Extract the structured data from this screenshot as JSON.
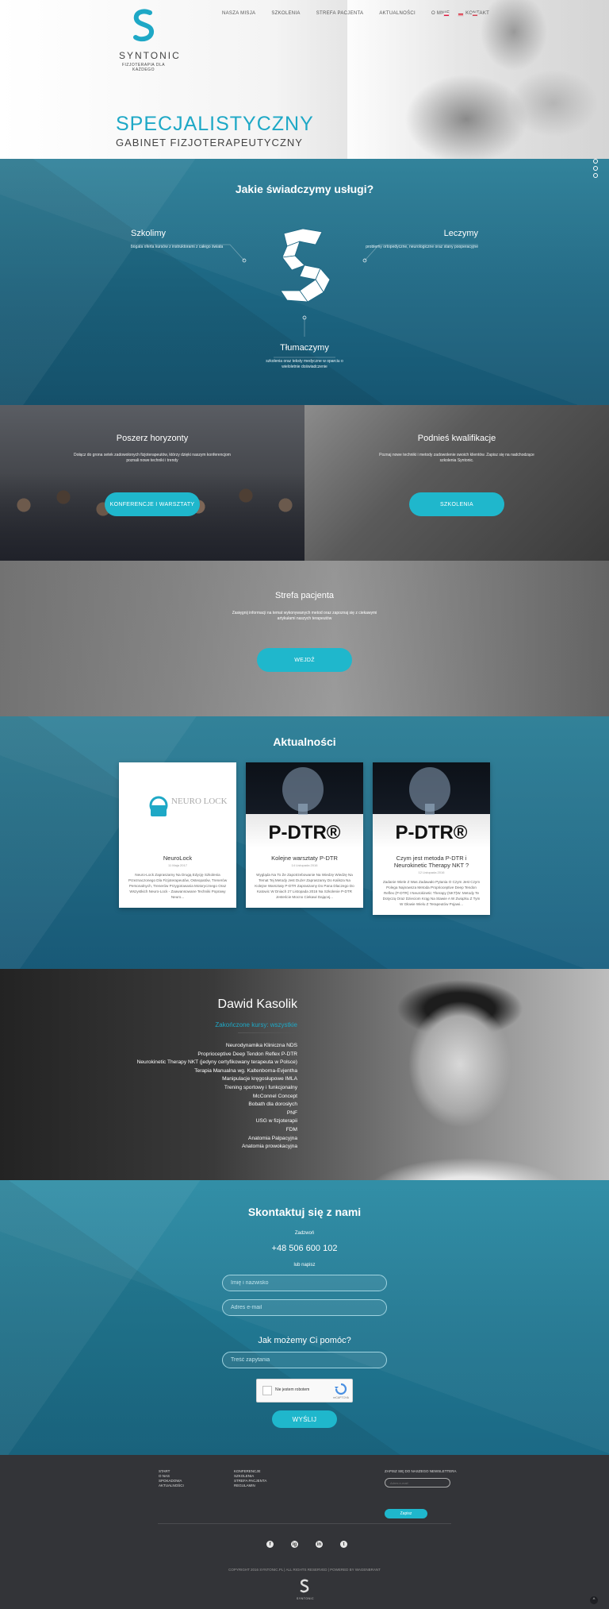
{
  "brand": {
    "name": "SYNTONIC",
    "tagline": "FIZJOTERAPIA DLA KAŻDEGO",
    "accent": "#1ea8c6",
    "button_color": "#1fb7cc"
  },
  "nav": {
    "items": [
      "NASZA MISJA",
      "SZKOLENIA",
      "STREFA PACJENTA",
      "AKTUALNOŚCI",
      "O MNIE",
      "KONTAKT"
    ]
  },
  "hero": {
    "title": "SPECJALISTYCZNY",
    "subtitle": "GABINET FIZJOTERAPEUTYCZNY"
  },
  "services": {
    "title": "Jakie świadczymy usługi?",
    "left": {
      "heading": "Szkolimy",
      "text": "bogata oferta kursów z instruktorami z całego świata"
    },
    "right": {
      "heading": "Leczymy",
      "text": "problemy ortopedyczne, neurologiczne oraz stany pooperacyjne"
    },
    "bottom": {
      "heading": "Tłumaczymy",
      "text": "szkolenia oraz teksty medyczne w oparciu o wieloletnie doświadczenie"
    }
  },
  "cta": {
    "left": {
      "heading": "Poszerz horyzonty",
      "text": "Dołącz do grona setek zadowolonych fizjoterapeutów, którzy dzięki naszym konferencjom poznali nowe techniki i trendy",
      "button": "KONFERENCJE I WARSZTATY"
    },
    "right": {
      "heading": "Podnieś kwalifikacje",
      "text": "Poznaj nowe techniki i metody zadowolenie swoich klientów. Zapisz się na nadchodzące szkolenia Syntonic.",
      "button": "SZKOLENIA"
    }
  },
  "patient_zone": {
    "heading": "Strefa pacjenta",
    "text": "Zasięgnij informacji na temat wykonywanych metod oraz zapoznaj się z ciekawymi artykułami naszych terapeutów",
    "button": "WEJDŹ"
  },
  "news": {
    "title": "Aktualności",
    "cards": [
      {
        "image_label": "NEURO LOCK",
        "title": "NeuroLock",
        "date": "11 Maja 2017",
        "text": "Neuro-Lock Zapraszamy Na Drugą Edycję Szkolenia Przeznaczonego Dla Fizjoterapeutów, Osteopatów, Trenerów Personalnych, Trenerów Przygotowania Motorycznego Oraz Wszystkich Neuro-Lock - Zaawansowane Techniki Poprawy Neuro..."
      },
      {
        "image_label": "P-DTR®",
        "title": "Kolejne warsztaty P-DTR",
        "date": "14 Listopada 2016",
        "text": "Wygląda Na To Że Zapotrzebowanie Na Wiedzę Wiedzę Na Temat Tej Metody Jest Duże! Zapraszamy Do Kalisza Na Kolejne Warsztaty P-DTR Zapraszamy Do Pana Dlaczego Do Katowic W Dniach 27 Listopada 2016 Na Szkolenie P-DTR Jesteście Mocno Ciekawi Dającej..."
      },
      {
        "image_label": "P-DTR®",
        "title": "Czym jest metoda P-DTR i Neurokinetic Therapy NKT ?",
        "date": "12 Listopada 2016",
        "text": "Zadanie Wiele Z Was Zadawało Pytania O Czym Jest Czym Polega Najnowsza Metoda Proprioceptive Deep Tendon Reflex (P-DTR) I Neurokinetic Therapy (NKT)W. Metody Te Dotyczą Oraz Dzieciom Krąg Na Stawie A W Związku Z Tym W Głowie Wielu Z Terapeutów Pojawi..."
      }
    ]
  },
  "profile": {
    "name": "Dawid Kasolik",
    "subtitle": "Zakończone kursy: wszystkie",
    "courses": [
      "Neurodynamika Kliniczna NDS",
      "Proprioceptive Deep Tendon Reflex P-DTR",
      "Neurokinetic Therapy NKT (jedyny certyfikowany terapeuta w Polsce)",
      "Terapia Manualna wg. Kaltenborna-Evjentha",
      "Manipulacje kręgosłupowe IMLA",
      "Trening sportowy i funkcjonalny",
      "McConnel Concept",
      "Bobath dla dorosłych",
      "PNF",
      "USG w fizjoterapii",
      "FDM",
      "Anatomia Palpacyjna",
      "Anatomia prowokacyjna"
    ]
  },
  "contact": {
    "title": "Skontaktuj się z nami",
    "call_label": "Zadzwoń",
    "phone": "+48 506 600 102",
    "or_label": "lub napisz",
    "name_placeholder": "Imię i nazwisko",
    "email_placeholder": "Adres e-mail",
    "help_title": "Jak możemy Ci pomóc?",
    "message_placeholder": "Treść zapytania",
    "captcha_label": "Nie jestem robotem",
    "captcha_brand": "reCAPTCHA",
    "submit": "WYŚLIJ"
  },
  "footer": {
    "col1": [
      "START",
      "O NAS",
      "SPOKADOWA",
      "AKTUALNOŚCI"
    ],
    "col2": [
      "KONFERENCJE",
      "SZKOLENIA",
      "STREFA PACJENTA",
      "REGULAMIN"
    ],
    "newsletter_title": "ZAPISZ SIĘ DO NASZEGO NEWSLETTERA",
    "newsletter_placeholder": "Adres e-mail",
    "newsletter_button": "Zapisz",
    "copyright": "COPYRIGHT 2016 SYNTONIC.PL | ALL RIGHTS RESERVED | POWERED BY WAGENBRANT",
    "logo_name": "SYNTONIC",
    "to_top": "^",
    "social": [
      "f",
      "ig",
      "in",
      "t"
    ]
  }
}
